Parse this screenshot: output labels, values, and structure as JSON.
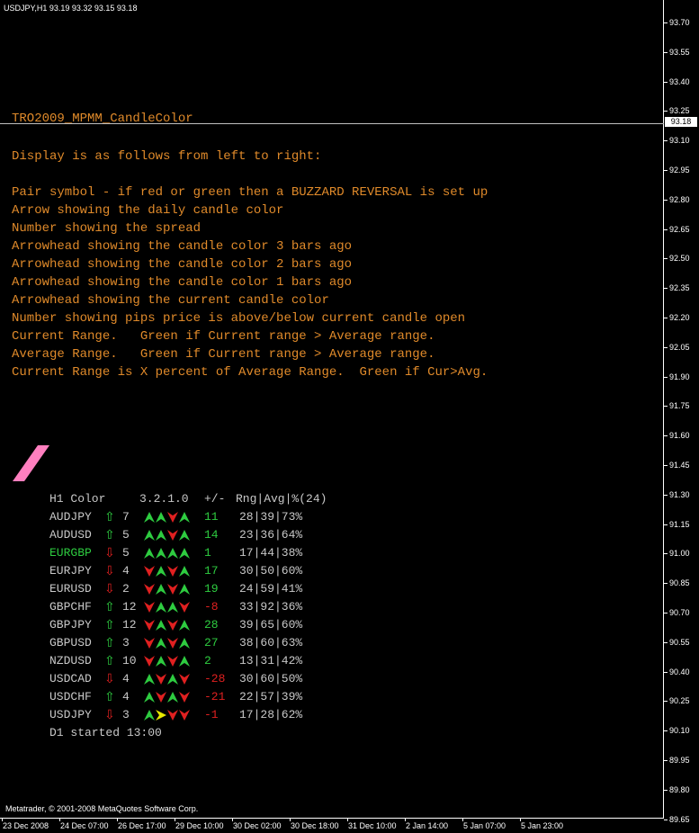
{
  "symbol_header": "USDJPY,H1  93.19 93.32 93.15 93.18",
  "price_axis": {
    "labels": [
      "93.70",
      "93.55",
      "93.40",
      "93.25",
      "93.10",
      "92.95",
      "92.80",
      "92.65",
      "92.50",
      "92.35",
      "92.20",
      "92.05",
      "91.90",
      "91.75",
      "91.60",
      "91.45",
      "91.30",
      "91.15",
      "91.00",
      "90.85",
      "90.70",
      "90.55",
      "90.40",
      "90.25",
      "90.10",
      "89.95",
      "89.80",
      "89.65"
    ],
    "current_price": "93.18"
  },
  "time_axis": [
    "23 Dec 2008",
    "24 Dec 07:00",
    "26 Dec 17:00",
    "29 Dec 10:00",
    "30 Dec 02:00",
    "30 Dec 18:00",
    "31 Dec 10:00",
    "2 Jan 14:00",
    "5 Jan 07:00",
    "5 Jan 23:00"
  ],
  "copyright": "Metatrader, © 2001-2008 MetaQuotes Software Corp.",
  "indicator": {
    "title": "TRO2009_MPMM_CandleColor",
    "description": [
      "Display is as follows from left to right:",
      "",
      "Pair symbol - if red or green then a BUZZARD REVERSAL is set up",
      "Arrow showing the daily candle color",
      "Number showing the spread",
      "Arrowhead showing the candle color 3 bars ago",
      "Arrowhead showing the candle color 2 bars ago",
      "Arrowhead showing the candle color 1 bars ago",
      "Arrowhead showing the current candle color",
      "Number showing pips price is above/below current candle open",
      "Current Range.   Green if Current range > Average range.",
      "Average Range.   Green if Current range > Average range.",
      "Current Range is X percent of Average Range.  Green if Cur>Avg."
    ],
    "text_color": "#e08a2a",
    "logo_color": "#ff7fbf"
  },
  "table": {
    "header": {
      "tf": "H1 Color",
      "bars": "3.2.1.0",
      "pips": "+/-",
      "ranges": "Rng|Avg|%(24)"
    },
    "colors": {
      "green": "#2ecc40",
      "red": "#e02020",
      "neutral": "#c8c8c8",
      "yellow": "#e8e800"
    },
    "rows": [
      {
        "pair": "AUDJPY",
        "pair_color": "neutral",
        "daily": "up",
        "spread": "7",
        "heads": [
          "up",
          "up",
          "down",
          "up"
        ],
        "pips": "11",
        "pips_color": "green",
        "ranges": "28|39|73%"
      },
      {
        "pair": "AUDUSD",
        "pair_color": "neutral",
        "daily": "up",
        "spread": "5",
        "heads": [
          "up",
          "up",
          "down",
          "up"
        ],
        "pips": "14",
        "pips_color": "green",
        "ranges": "23|36|64%"
      },
      {
        "pair": "EURGBP",
        "pair_color": "green",
        "daily": "down",
        "spread": "5",
        "heads": [
          "up",
          "up",
          "up",
          "up"
        ],
        "pips": "1",
        "pips_color": "green",
        "ranges": "17|44|38%"
      },
      {
        "pair": "EURJPY",
        "pair_color": "neutral",
        "daily": "down",
        "spread": "4",
        "heads": [
          "down",
          "up",
          "down",
          "up"
        ],
        "pips": "17",
        "pips_color": "green",
        "ranges": "30|50|60%"
      },
      {
        "pair": "EURUSD",
        "pair_color": "neutral",
        "daily": "down",
        "spread": "2",
        "heads": [
          "down",
          "up",
          "down",
          "up"
        ],
        "pips": "19",
        "pips_color": "green",
        "ranges": "24|59|41%"
      },
      {
        "pair": "GBPCHF",
        "pair_color": "neutral",
        "daily": "up",
        "spread": "12",
        "heads": [
          "down",
          "up",
          "up",
          "down"
        ],
        "pips": "-8",
        "pips_color": "red",
        "ranges": "33|92|36%"
      },
      {
        "pair": "GBPJPY",
        "pair_color": "neutral",
        "daily": "up",
        "spread": "12",
        "heads": [
          "down",
          "up",
          "down",
          "up"
        ],
        "pips": "28",
        "pips_color": "green",
        "ranges": "39|65|60%"
      },
      {
        "pair": "GBPUSD",
        "pair_color": "neutral",
        "daily": "up",
        "spread": "3",
        "heads": [
          "down",
          "up",
          "down",
          "up"
        ],
        "pips": "27",
        "pips_color": "green",
        "ranges": "38|60|63%"
      },
      {
        "pair": "NZDUSD",
        "pair_color": "neutral",
        "daily": "up",
        "spread": "10",
        "heads": [
          "down",
          "up",
          "down",
          "up"
        ],
        "pips": "2",
        "pips_color": "green",
        "ranges": "13|31|42%"
      },
      {
        "pair": "USDCAD",
        "pair_color": "neutral",
        "daily": "down",
        "spread": "4",
        "heads": [
          "up",
          "down",
          "up",
          "down"
        ],
        "pips": "-28",
        "pips_color": "red",
        "ranges": "30|60|50%"
      },
      {
        "pair": "USDCHF",
        "pair_color": "neutral",
        "daily": "up",
        "spread": "4",
        "heads": [
          "up",
          "down",
          "up",
          "down"
        ],
        "pips": "-21",
        "pips_color": "red",
        "ranges": "22|57|39%"
      },
      {
        "pair": "USDJPY",
        "pair_color": "neutral",
        "daily": "down",
        "spread": "3",
        "heads": [
          "up",
          "right",
          "down",
          "down"
        ],
        "pips": "-1",
        "pips_color": "red",
        "ranges": "17|28|62%"
      }
    ],
    "footer": "D1 started 13:00"
  }
}
